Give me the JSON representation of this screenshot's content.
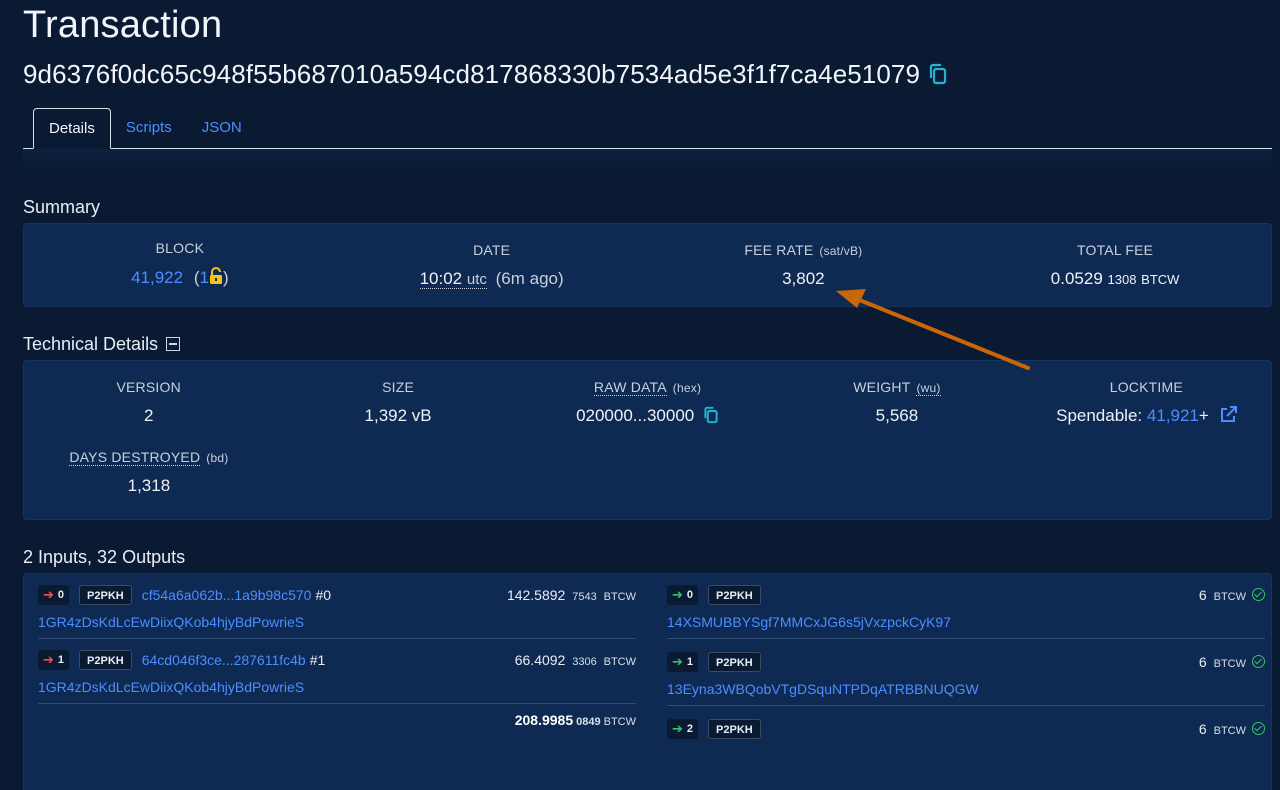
{
  "page": {
    "title": "Transaction",
    "txid": "9d6376f0dc65c948f55b687010a594cd817868330b7534ad5e3f1f7ca4e51079"
  },
  "tabs": [
    {
      "label": "Details"
    },
    {
      "label": "Scripts"
    },
    {
      "label": "JSON"
    }
  ],
  "summary": {
    "title": "Summary",
    "block": {
      "label": "BLOCK",
      "value": "41,922",
      "confirmations": "1",
      "open": "(",
      "close": ")"
    },
    "date": {
      "label": "DATE",
      "time": "10:02",
      "tz": "utc",
      "ago": "(6m ago)"
    },
    "fee_rate": {
      "label": "FEE RATE",
      "unit": "(sat/vB)",
      "value": "3,802"
    },
    "total_fee": {
      "label": "TOTAL FEE",
      "value": "0.0529",
      "sub": "1308",
      "unit": "BTCW"
    }
  },
  "technical": {
    "title": "Technical Details",
    "version": {
      "label": "VERSION",
      "value": "2"
    },
    "size": {
      "label": "SIZE",
      "value": "1,392 vB"
    },
    "raw_data": {
      "label": "RAW DATA",
      "unit": "(hex)",
      "value": "020000...30000"
    },
    "weight": {
      "label": "WEIGHT",
      "unit": "(wu)",
      "value": "5,568"
    },
    "locktime": {
      "label": "LOCKTIME",
      "prefix": "Spendable:",
      "block": "41,921",
      "suffix": "+"
    },
    "days_destroyed": {
      "label": "DAYS DESTROYED",
      "unit": "(bd)",
      "value": "1,318"
    }
  },
  "io": {
    "title": "2 Inputs, 32 Outputs",
    "inputs": [
      {
        "index": "0",
        "type": "P2PKH",
        "prev_tx": "cf54a6a062b...1a9b98c570",
        "vout": "#0",
        "amount": "142.5892",
        "amount_sub": "7543",
        "unit": "BTCW",
        "address": "1GR4zDsKdLcEwDiixQKob4hjyBdPowrieS"
      },
      {
        "index": "1",
        "type": "P2PKH",
        "prev_tx": "64cd046f3ce...287611fc4b",
        "vout": "#1",
        "amount": "66.4092",
        "amount_sub": "3306",
        "unit": "BTCW",
        "address": "1GR4zDsKdLcEwDiixQKob4hjyBdPowrieS"
      }
    ],
    "input_total": {
      "amount": "208.9985",
      "sub": "0849",
      "unit": "BTCW"
    },
    "outputs": [
      {
        "index": "0",
        "type": "P2PKH",
        "amount": "6",
        "unit": "BTCW",
        "address": "14XSMUBBYSgf7MMCxJG6s5jVxzpckCyK97"
      },
      {
        "index": "1",
        "type": "P2PKH",
        "amount": "6",
        "unit": "BTCW",
        "address": "13Eyna3WBQobVTgDSquNTPDqATRBBNUQGW"
      },
      {
        "index": "2",
        "type": "P2PKH",
        "amount": "6",
        "unit": "BTCW",
        "address": ""
      }
    ]
  },
  "colors": {
    "background": "#0a1a33",
    "card": "#0f2a52",
    "link": "#4d8dff",
    "accent_arrow": "#c8660a",
    "lock": "#f5c518",
    "spent_green": "#36c46a"
  }
}
